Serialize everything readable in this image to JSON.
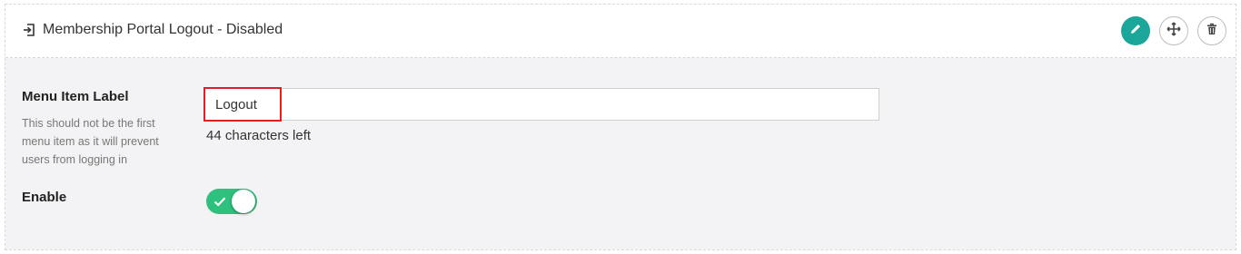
{
  "header": {
    "title": "Membership Portal Logout - Disabled",
    "icon": "logout-icon",
    "buttons": {
      "edit_icon": "pencil-icon",
      "move_icon": "move-arrows-icon",
      "delete_icon": "trash-icon"
    },
    "accent_color": "#1aa699"
  },
  "form": {
    "menu_item": {
      "label": "Menu Item Label",
      "help": "This should not be the first menu item as it will prevent users from logging in",
      "value": "Logout",
      "chars_left_count": "44",
      "chars_left_text": "characters left"
    },
    "enable": {
      "label": "Enable",
      "on": true,
      "color": "#2ec07d"
    }
  }
}
